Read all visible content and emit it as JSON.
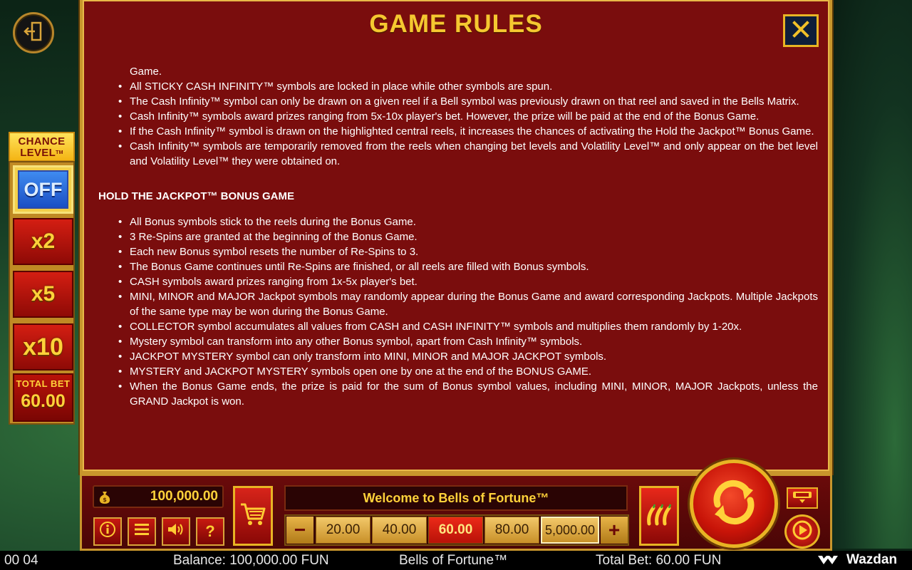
{
  "rules": {
    "title": "GAME RULES",
    "items_top": [
      {
        "text": "Game.",
        "continuation": true
      },
      {
        "text": "All STICKY CASH INFINITY™ symbols are locked in place while other symbols are spun."
      },
      {
        "text": "The Cash Infinity™ symbol can only be drawn on a given reel if a Bell symbol was previously drawn on that reel and saved in the Bells Matrix."
      },
      {
        "text": "Cash Infinity™ symbols award prizes ranging from 5x-10x player's bet. However, the prize will be paid at the end of the Bonus Game."
      },
      {
        "text": "If the Cash Infinity™ symbol is drawn on the highlighted central reels, it increases the chances of activating the Hold the Jackpot™ Bonus Game."
      },
      {
        "text": "Cash Infinity™ symbols are temporarily removed from the reels when changing bet levels and Volatility Level™ and only appear on the bet level and Volatility Level™ they were obtained on."
      }
    ],
    "section_heading": "HOLD THE JACKPOT™ BONUS GAME",
    "items_bonus": [
      "All Bonus symbols stick to the reels during the Bonus Game.",
      "3 Re-Spins are granted at the beginning of the Bonus Game.",
      "Each new Bonus symbol resets the number of Re-Spins to 3.",
      "The Bonus Game continues until Re-Spins are finished, or all reels are filled with Bonus symbols.",
      "CASH symbols award prizes ranging from 1x-5x player's bet.",
      "MINI, MINOR and MAJOR Jackpot symbols may randomly appear during the Bonus Game and award corresponding Jackpots. Multiple Jackpots of the same type may be won during the Bonus Game.",
      "COLLECTOR symbol accumulates all values from CASH and CASH INFINITY™ symbols and multiplies them randomly by 1-20x.",
      "Mystery symbol can transform into any other Bonus symbol, apart from Cash Infinity™ symbols.",
      "JACKPOT MYSTERY symbol can only transform into MINI, MINOR and MAJOR JACKPOT symbols.",
      "MYSTERY and JACKPOT MYSTERY symbols open one by one at the end of the BONUS GAME.",
      "When the Bonus Game ends, the prize is paid for the sum of Bonus symbol values, including MINI, MINOR, MAJOR Jackpots, unless the GRAND Jackpot is won."
    ]
  },
  "chance_level": {
    "title_line1": "CHANCE",
    "title_line2": "LEVEL",
    "tm": "TM",
    "options": [
      "OFF",
      "x2",
      "x5",
      "x10"
    ],
    "selected": "OFF",
    "total_bet_label": "TOTAL BET",
    "total_bet_value": "60.00"
  },
  "controls": {
    "balance_display": "100,000.00",
    "welcome_message": "Welcome to Bells of Fortune™",
    "bet_minus": "−",
    "bet_plus": "+",
    "bet_options": [
      "20.00",
      "40.00",
      "60.00",
      "80.00",
      "5,000.00"
    ],
    "selected_bet": "60.00",
    "small_buttons": [
      "info",
      "menu",
      "sound",
      "?"
    ],
    "question_label": "?"
  },
  "status": {
    "time": "00 04",
    "balance": "Balance: 100,000.00 FUN",
    "game_name": "Bells of Fortune™",
    "total_bet": "Total Bet: 60.00 FUN",
    "brand": "Wazdan"
  },
  "icons": {
    "exit": "exit-door-icon",
    "close": "close-x-icon",
    "cart": "shopping-cart-icon",
    "chili": "chili-peppers-icon",
    "spin": "spin-arrows-icon",
    "autoplay": "autoplay-icon",
    "info": "info-icon",
    "menu": "hamburger-menu-icon",
    "sound": "speaker-icon",
    "bag": "money-bag-icon"
  },
  "colors": {
    "panel_red": "#7a0d0d",
    "gold": "#f5c830",
    "selected_red": "#e2261a",
    "off_blue": "#2a6ee0"
  }
}
